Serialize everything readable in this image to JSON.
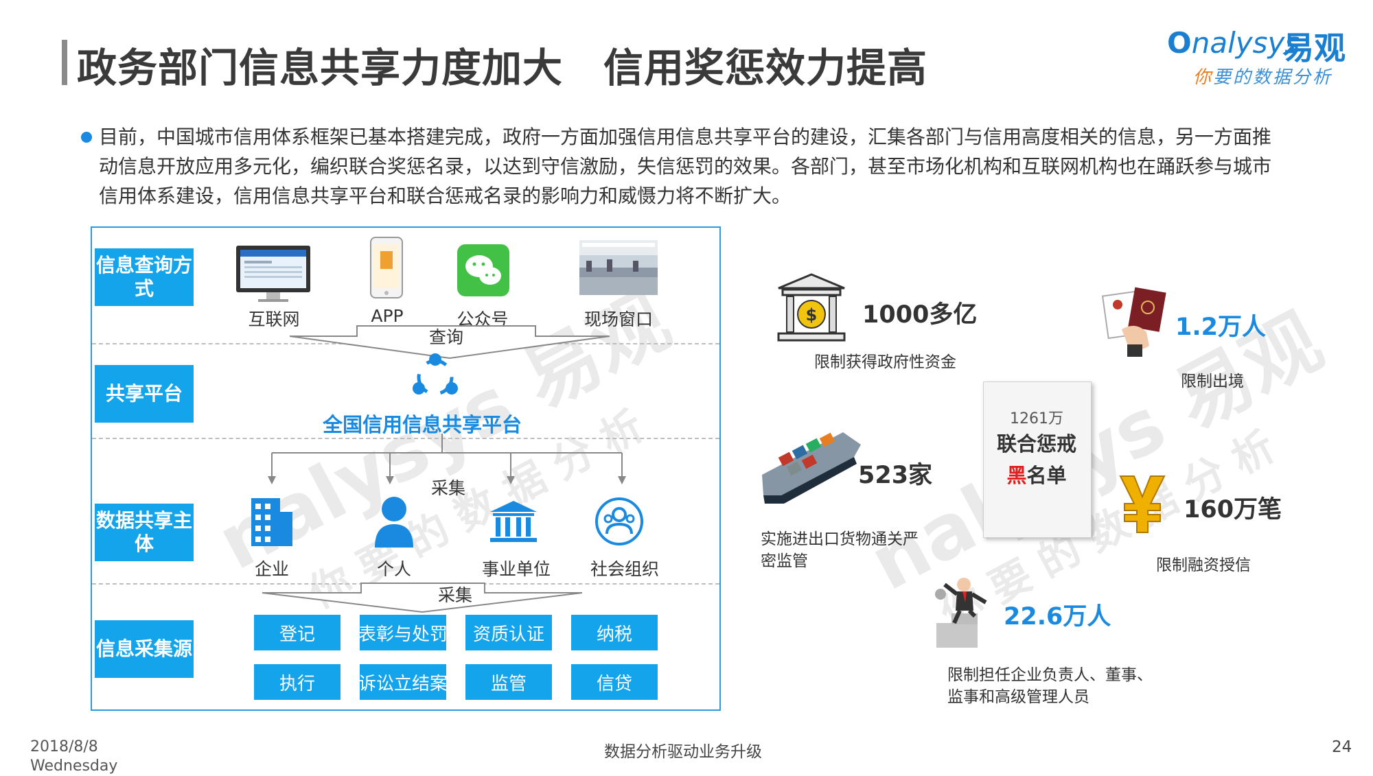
{
  "header": {
    "title": "政务部门信息共享力度加大　信用奖惩效力提高",
    "logo_en_prefix": "O",
    "logo_en": "nalysys",
    "logo_cn": "易观",
    "logo_slogan_first": "你",
    "logo_slogan_rest": "要的数据分析"
  },
  "intro": "目前，中国城市信用体系框架已基本搭建完成，政府一方面加强信用信息共享平台的建设，汇集各部门与信用高度相关的信息，另一方面推动信息开放应用多元化，编织联合奖惩名录，以达到守信激励，失信惩罚的效果。各部门，甚至市场化机构和互联网机构也在踊跃参与城市信用体系建设，信用信息共享平台和联合惩戒名录的影响力和威慑力将不断扩大。",
  "diagram": {
    "sections": [
      "信息查询方式",
      "共享平台",
      "数据共享主体",
      "信息采集源"
    ],
    "query_methods": [
      "互联网",
      "APP",
      "公众号",
      "现场窗口"
    ],
    "query_arrow_label": "查询",
    "platform_name": "全国信用信息共享平台",
    "collect_label_1": "采集",
    "entities": [
      "企业",
      "个人",
      "事业单位",
      "社会组织"
    ],
    "collect_label_2": "采集",
    "sources": [
      "登记",
      "表彰与处罚",
      "资质认证",
      "纳税",
      "执行",
      "诉讼立结案",
      "监管",
      "信贷"
    ]
  },
  "infographic": {
    "blacklist_count": "1261万",
    "blacklist_line1": "联合惩戒",
    "blacklist_red": "黑",
    "blacklist_rest": "名单",
    "stats": [
      {
        "value": "1000多亿",
        "caption": "限制获得政府性资金",
        "color": "#333333",
        "icon": "bank-money-icon"
      },
      {
        "value": "1.2万人",
        "caption": "限制出境",
        "color": "#1a8ae0",
        "icon": "passport-icon"
      },
      {
        "value": "523家",
        "caption": "实施进出口货物通关严密监管",
        "color": "#333333",
        "icon": "cargo-ship-icon"
      },
      {
        "value": "160万笔",
        "caption": "限制融资授信",
        "color": "#333333",
        "icon": "yen-icon"
      },
      {
        "value": "22.6万人",
        "caption": "限制担任企业负责人、董事、监事和高级管理人员",
        "color": "#1a8ae0",
        "icon": "businessman-icon"
      }
    ]
  },
  "watermark": {
    "en": "nalysys 易观",
    "cn": "你要的数据分析"
  },
  "footer": {
    "date": "2018/8/8",
    "weekday": "Wednesday",
    "center": "数据分析驱动业务升级",
    "page": "24"
  },
  "colors": {
    "accent": "#13a4ec",
    "brand": "#1a7fd0",
    "highlight_red": "#e02020"
  }
}
